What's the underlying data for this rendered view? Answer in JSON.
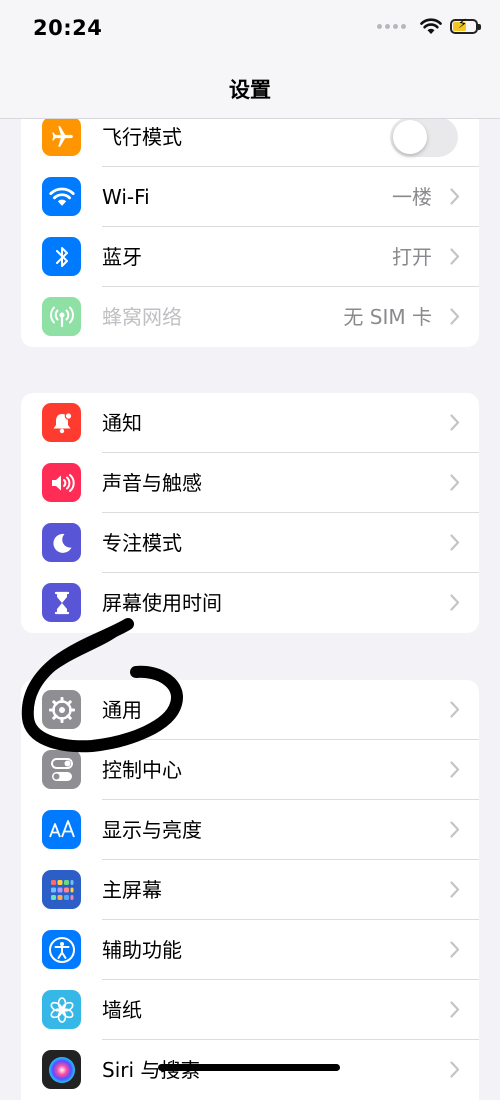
{
  "status_bar": {
    "time": "20:24"
  },
  "nav": {
    "title": "设置"
  },
  "groups": [
    {
      "items": [
        {
          "label": "飞行模式",
          "icon": "airplane-icon",
          "color": "#ff9500",
          "toggle": false
        },
        {
          "label": "Wi-Fi",
          "icon": "wifi-icon",
          "color": "#007aff",
          "value": "一楼"
        },
        {
          "label": "蓝牙",
          "icon": "bluetooth-icon",
          "color": "#007aff",
          "value": "打开"
        },
        {
          "label": "蜂窝网络",
          "icon": "cellular-icon",
          "color": "#34c759",
          "value": "无 SIM 卡",
          "disabled": true
        }
      ]
    },
    {
      "items": [
        {
          "label": "通知",
          "icon": "bell-icon",
          "color": "#ff3b30"
        },
        {
          "label": "声音与触感",
          "icon": "speaker-icon",
          "color": "#ff2d55"
        },
        {
          "label": "专注模式",
          "icon": "moon-icon",
          "color": "#5856d6"
        },
        {
          "label": "屏幕使用时间",
          "icon": "hourglass-icon",
          "color": "#5856d6"
        }
      ]
    },
    {
      "items": [
        {
          "label": "通用",
          "icon": "gear-icon",
          "color": "#8e8e93"
        },
        {
          "label": "控制中心",
          "icon": "switches-icon",
          "color": "#8e8e93"
        },
        {
          "label": "显示与亮度",
          "icon": "text-size-icon",
          "color": "#007aff"
        },
        {
          "label": "主屏幕",
          "icon": "app-grid-icon",
          "color": "#2c5ec8"
        },
        {
          "label": "辅助功能",
          "icon": "accessibility-icon",
          "color": "#007aff"
        },
        {
          "label": "墙纸",
          "icon": "flower-icon",
          "color": "#35b8e8"
        },
        {
          "label": "Siri 与搜索",
          "icon": "siri-icon",
          "color": "#222222"
        }
      ]
    }
  ]
}
